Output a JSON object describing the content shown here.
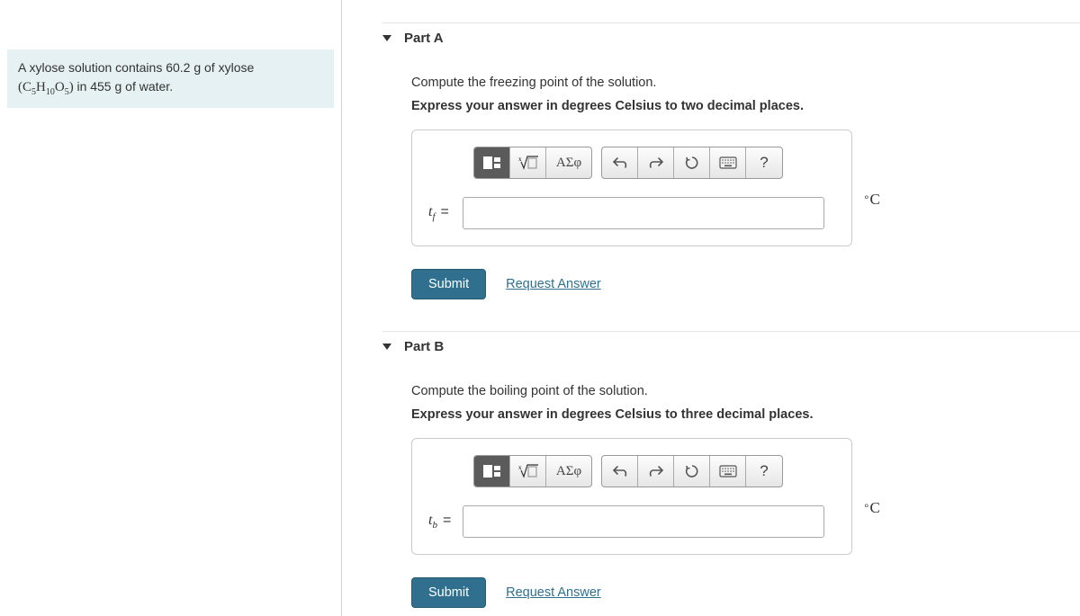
{
  "problem": {
    "line1": "A xylose solution contains 60.2 g of xylose",
    "formula_prefix": "(",
    "formula": "C5H10O5",
    "formula_display_parts": {
      "c_base": "C",
      "c_sub": "5",
      "h_base": "H",
      "h_sub": "10",
      "o_base": "O",
      "o_sub": "5"
    },
    "formula_suffix": ")",
    "line2_rest": " in 455 g of water."
  },
  "partA": {
    "title": "Part A",
    "question": "Compute the freezing point of the solution.",
    "instruction": "Express your answer in degrees Celsius to two decimal places.",
    "variable_base": "t",
    "variable_sub": "f",
    "equals": "=",
    "unit": "°C",
    "submit_label": "Submit",
    "request_label": "Request Answer",
    "toolbar": {
      "greek": "ΑΣφ",
      "help": "?"
    }
  },
  "partB": {
    "title": "Part B",
    "question": "Compute the boiling point of the solution.",
    "instruction": "Express your answer in degrees Celsius to three decimal places.",
    "variable_base": "t",
    "variable_sub": "b",
    "equals": "=",
    "unit": "°C",
    "submit_label": "Submit",
    "request_label": "Request Answer",
    "toolbar": {
      "greek": "ΑΣφ",
      "help": "?"
    }
  }
}
